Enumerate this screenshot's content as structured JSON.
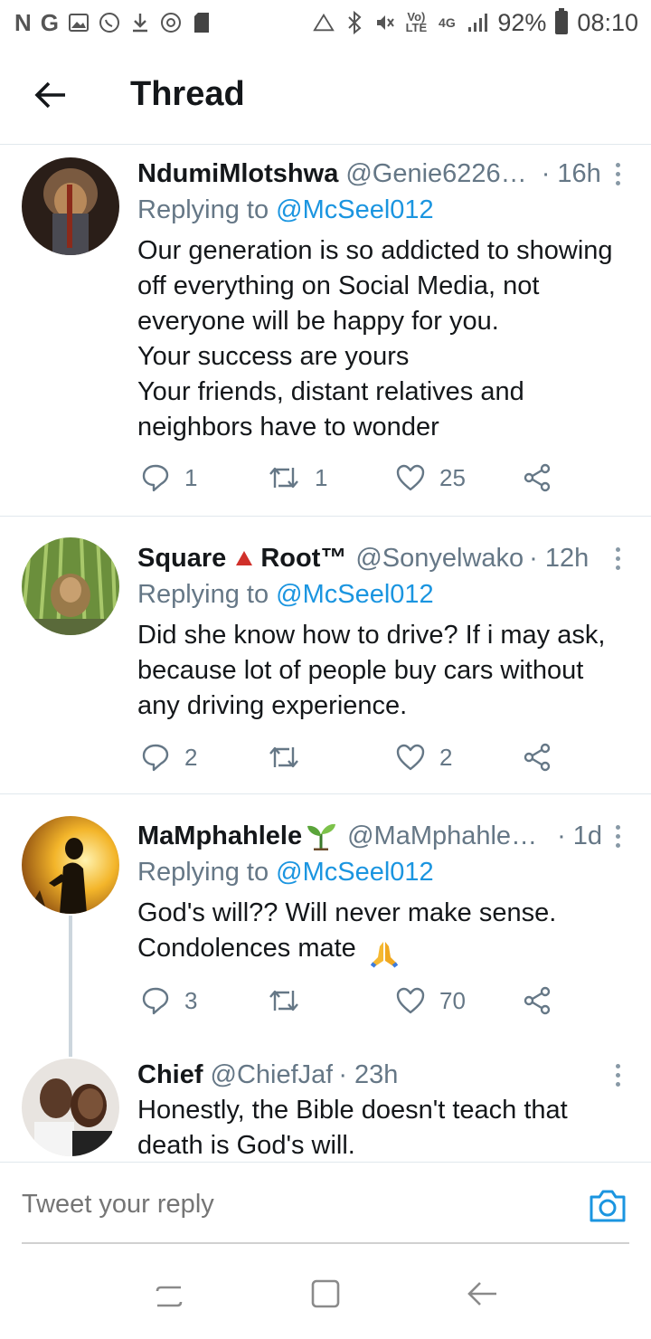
{
  "status_bar": {
    "left_icons": [
      "N",
      "G",
      "gallery-icon",
      "whatsapp-icon",
      "download-icon",
      "sync-icon",
      "sdcard-icon"
    ],
    "battery": "92%",
    "time": "08:10",
    "network": "4G"
  },
  "header": {
    "title": "Thread"
  },
  "tweets": [
    {
      "name": "NdumiMlotshwa",
      "handle": "@Genie6226…",
      "time": "· 16h",
      "replying_prefix": "Replying to ",
      "replying_to": "@McSeel012",
      "text": "Our generation is so addicted to showing\noff everything on Social Media, not\neveryone will be happy for you.\nYour success are yours\nYour friends, distant relatives and\nneighbors have to wonder",
      "replies": "1",
      "retweets": "1",
      "likes": "25",
      "avatar_color": "#5a3a28"
    },
    {
      "name": "Square",
      "name_suffix": "Root™",
      "handle": "@Sonyelwako",
      "time": "· 12h",
      "replying_prefix": "Replying to ",
      "replying_to": "@McSeel012",
      "text": "Did she know how to drive? If i may ask,\nbecause lot of people buy cars without\nany driving experience.",
      "replies": "2",
      "retweets": "",
      "likes": "2",
      "avatar_color": "#4f7a3a"
    },
    {
      "name": "MaMphahlele",
      "handle": "@MaMphahlel…",
      "time": "· 1d",
      "replying_prefix": "Replying to ",
      "replying_to": "@McSeel012",
      "text": "God's will?? Will never make sense.\nCondolences mate",
      "replies": "3",
      "retweets": "",
      "likes": "70",
      "avatar_color": "#e0a020"
    },
    {
      "name": "Chief",
      "handle": "@ChiefJaf",
      "time": "· 23h",
      "text": "Honestly, the Bible doesn't teach that\ndeath is God's will.",
      "avatar_color": "#6b5a50"
    }
  ],
  "reply_bar": {
    "placeholder": "Tweet your reply"
  },
  "colors": {
    "link": "#1b95e0",
    "muted": "#657786",
    "divider": "#e1e8ed"
  }
}
